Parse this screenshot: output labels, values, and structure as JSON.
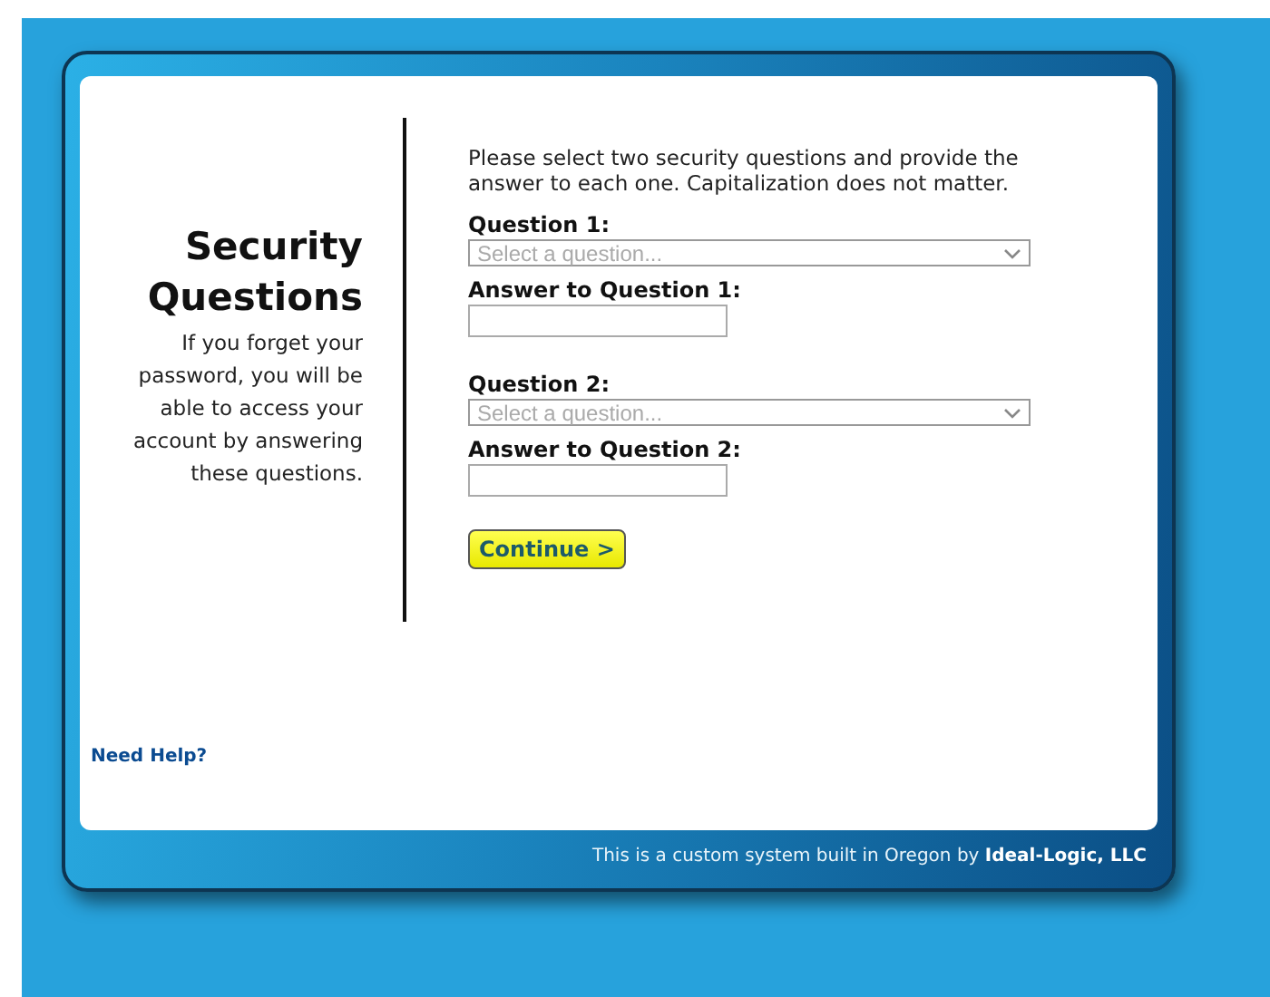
{
  "sidebar": {
    "title": "Security Questions",
    "description": "If you forget your password, you will be able to access your account by answering these questions.",
    "help_link": "Need Help?"
  },
  "form": {
    "intro": "Please select two security questions and provide the answer to each one. Capitalization does not matter.",
    "questions": [
      {
        "label": "Question 1:",
        "placeholder": "Select a question...",
        "answer_label": "Answer to Question 1:"
      },
      {
        "label": "Question 2:",
        "placeholder": "Select a question...",
        "answer_label": "Answer to Question 2:"
      }
    ],
    "button": "Continue >"
  },
  "footer": "This is a custom system built in Oregon by **Ideal-Logic, LLC**"
}
